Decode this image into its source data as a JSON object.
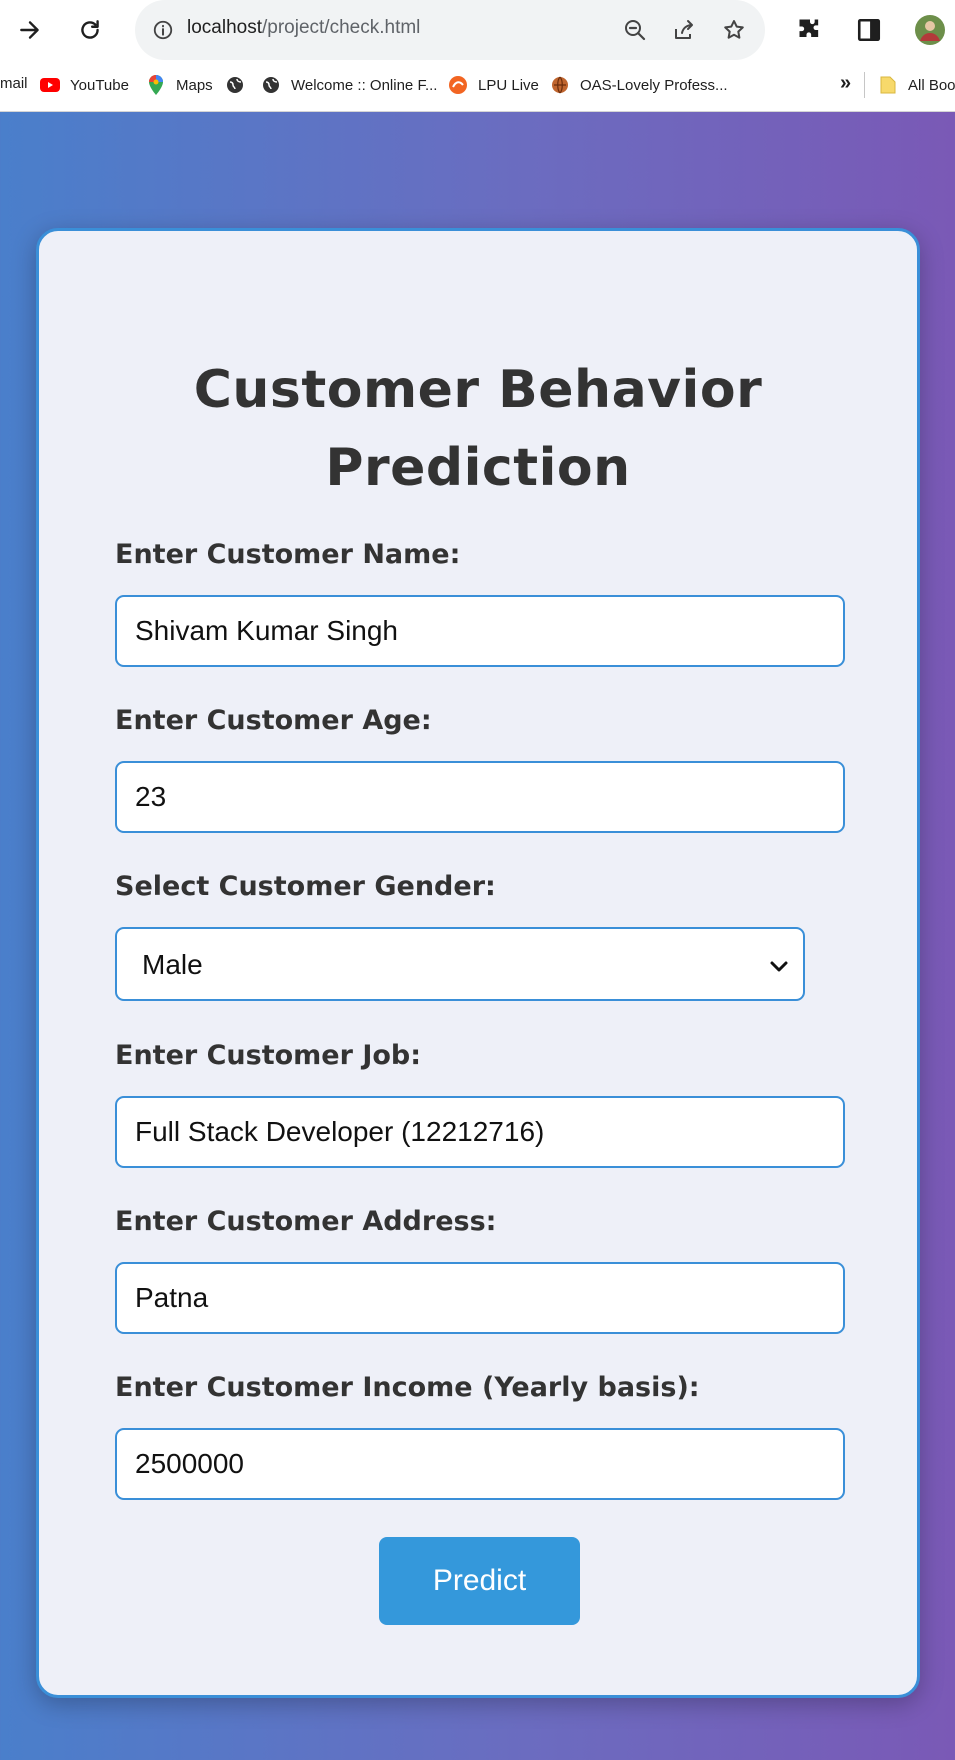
{
  "browser": {
    "url_host": "localhost",
    "url_path": "/project/check.html",
    "bookmarks": [
      {
        "label": "mail",
        "icon": "gmail-icon"
      },
      {
        "label": "YouTube",
        "icon": "youtube-icon"
      },
      {
        "label": "Maps",
        "icon": "maps-icon"
      },
      {
        "label": "",
        "icon": "globe-icon"
      },
      {
        "label": "Welcome :: Online F...",
        "icon": "globe-icon"
      },
      {
        "label": "LPU Live",
        "icon": "lpu-live-icon"
      },
      {
        "label": "OAS-Lovely Profess...",
        "icon": "oas-icon"
      }
    ],
    "overflow_label": "»",
    "all_bookmarks_label": "All Boo"
  },
  "form": {
    "title": "Customer Behavior Prediction",
    "name": {
      "label": "Enter Customer Name:",
      "value": "Shivam Kumar Singh"
    },
    "age": {
      "label": "Enter Customer Age:",
      "value": "23"
    },
    "gender": {
      "label": "Select Customer Gender:",
      "value": "Male"
    },
    "job": {
      "label": "Enter Customer Job:",
      "value": "Full Stack Developer (12212716)"
    },
    "address": {
      "label": "Enter Customer Address:",
      "value": "Patna"
    },
    "income": {
      "label": "Enter Customer Income (Yearly basis):",
      "value": "2500000"
    },
    "submit_label": "Predict"
  },
  "colors": {
    "accent": "#3498db",
    "border": "#3a8fd8",
    "gradient_start": "#4a7fcb",
    "gradient_end": "#7a59b6",
    "card_bg": "#eef0f8"
  }
}
